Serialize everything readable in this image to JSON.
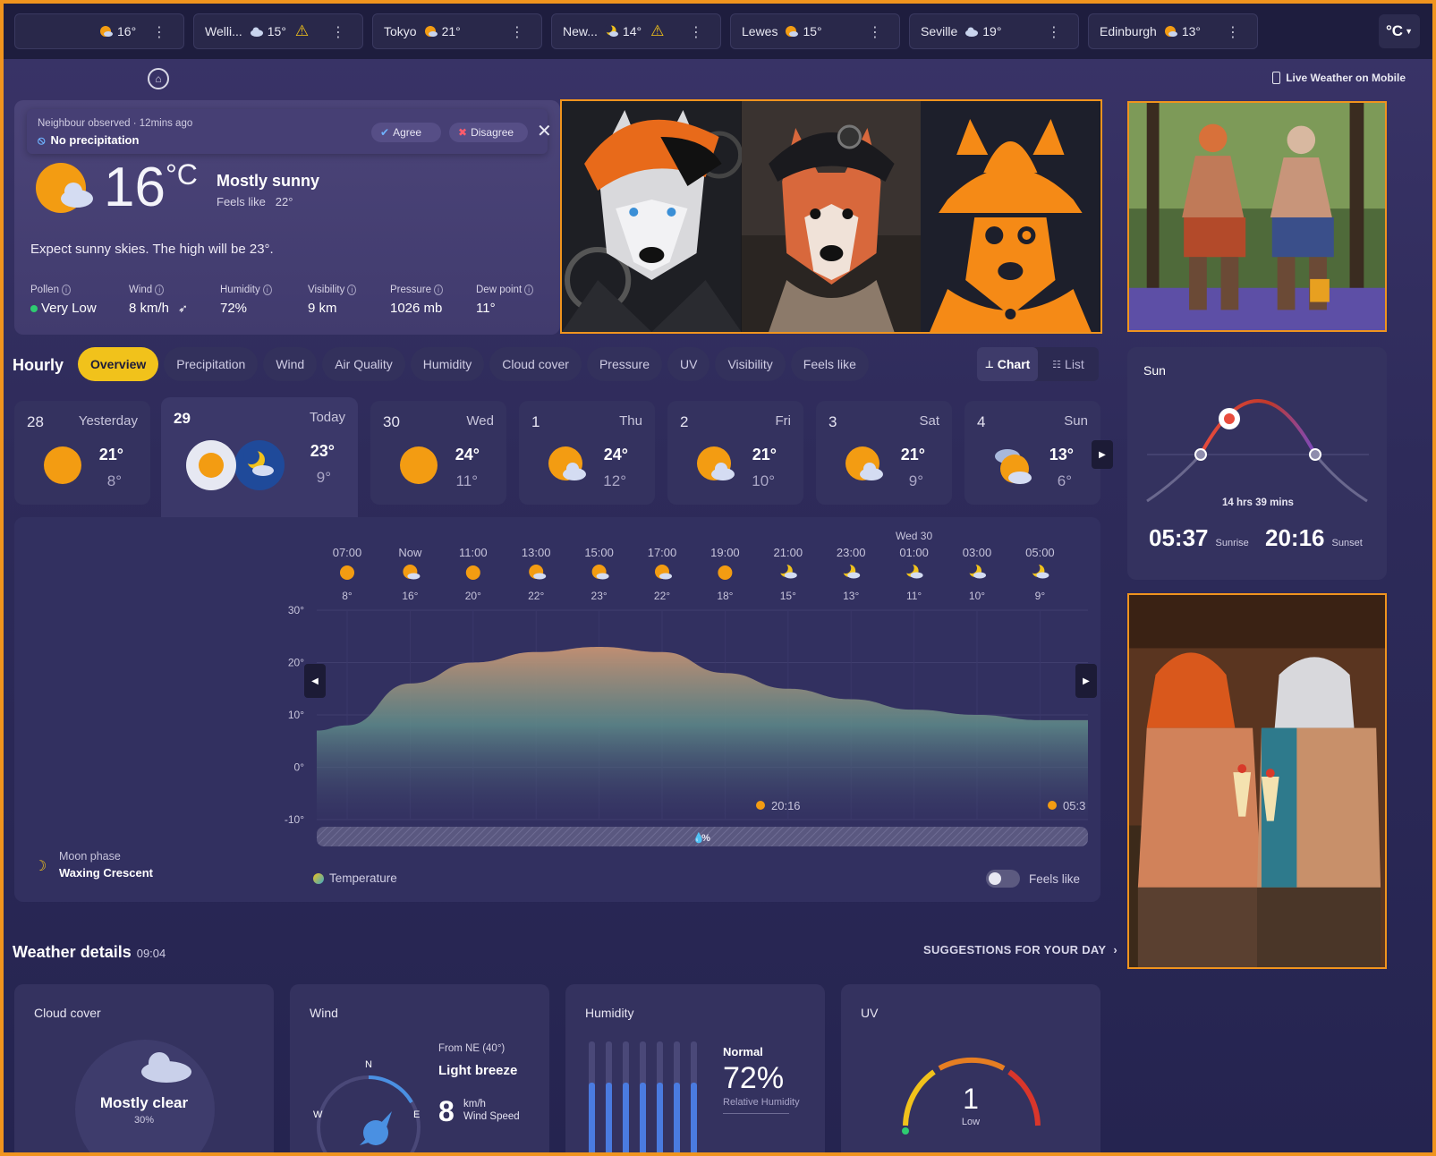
{
  "cities": [
    {
      "name": "",
      "temp": "16°",
      "icon": "sun-cloud-icon",
      "warning": false
    },
    {
      "name": "Welli...",
      "temp": "15°",
      "icon": "cloud-icon",
      "warning": true
    },
    {
      "name": "Tokyo",
      "temp": "21°",
      "icon": "sun-cloud-icon",
      "warning": false
    },
    {
      "name": "New...",
      "temp": "14°",
      "icon": "moon-cloud-icon",
      "warning": true
    },
    {
      "name": "Lewes",
      "temp": "15°",
      "icon": "sun-cloud-icon",
      "warning": false
    },
    {
      "name": "Seville",
      "temp": "19°",
      "icon": "cloud-icon",
      "warning": false
    },
    {
      "name": "Edinburgh",
      "temp": "13°",
      "icon": "sun-cloud-icon",
      "warning": false
    }
  ],
  "unit_button": "°C",
  "mobile_link": "Live Weather on Mobile",
  "observation": {
    "meta": "Neighbour observed · 12mins ago",
    "status": "No precipitation",
    "agree": "Agree",
    "disagree": "Disagree"
  },
  "current": {
    "temp": "16",
    "unit": "°C",
    "condition": "Mostly sunny",
    "feels_like_label": "Feels like",
    "feels_like": "22°",
    "summary": "Expect sunny skies. The high will be 23°."
  },
  "metrics": [
    {
      "label": "Pollen",
      "value": "Very Low"
    },
    {
      "label": "Wind",
      "value": "8 km/h"
    },
    {
      "label": "Humidity",
      "value": "72%"
    },
    {
      "label": "Visibility",
      "value": "9 km"
    },
    {
      "label": "Pressure",
      "value": "1026 mb"
    },
    {
      "label": "Dew point",
      "value": "11°"
    }
  ],
  "hourly": {
    "title": "Hourly",
    "tabs": [
      "Overview",
      "Precipitation",
      "Wind",
      "Air Quality",
      "Humidity",
      "Cloud cover",
      "Pressure",
      "UV",
      "Visibility",
      "Feels like"
    ],
    "active_tab": "Overview",
    "view_chart": "Chart",
    "view_list": "List"
  },
  "days": [
    {
      "num": "28",
      "label": "Yesterday",
      "hi": "21°",
      "lo": "8°",
      "icon": "sun-icon"
    },
    {
      "num": "29",
      "label": "Today",
      "hi": "23°",
      "lo": "9°",
      "icon": "sun-icon"
    },
    {
      "num": "30",
      "label": "Wed",
      "hi": "24°",
      "lo": "11°",
      "icon": "sun-icon"
    },
    {
      "num": "1",
      "label": "Thu",
      "hi": "24°",
      "lo": "12°",
      "icon": "sun-cloud-icon"
    },
    {
      "num": "2",
      "label": "Fri",
      "hi": "21°",
      "lo": "10°",
      "icon": "sun-cloud-icon"
    },
    {
      "num": "3",
      "label": "Sat",
      "hi": "21°",
      "lo": "9°",
      "icon": "sun-cloud-icon"
    },
    {
      "num": "4",
      "label": "Sun",
      "hi": "13°",
      "lo": "6°",
      "icon": "cloud-sun-icon"
    }
  ],
  "chart_data": {
    "type": "area",
    "x": [
      "07:00",
      "Now",
      "11:00",
      "13:00",
      "15:00",
      "17:00",
      "19:00",
      "21:00",
      "23:00",
      "01:00",
      "03:00",
      "05:00"
    ],
    "x_date_note": "Wed 30",
    "values": [
      8,
      16,
      20,
      22,
      23,
      22,
      18,
      15,
      13,
      11,
      10,
      9
    ],
    "value_labels": [
      "8°",
      "16°",
      "20°",
      "22°",
      "23°",
      "22°",
      "18°",
      "15°",
      "13°",
      "11°",
      "10°",
      "9°"
    ],
    "icons": [
      "sun-icon",
      "sun-cloud-icon",
      "sun-icon",
      "sun-cloud-icon",
      "sun-cloud-icon",
      "sun-cloud-icon",
      "sun-icon",
      "moon-cloud-icon",
      "moon-cloud-icon",
      "moon-cloud-icon",
      "moon-cloud-icon",
      "moon-cloud-icon"
    ],
    "y_ticks": [
      "30°",
      "20°",
      "10°",
      "0°",
      "-10°"
    ],
    "y_tick_values": [
      30,
      20,
      10,
      0,
      -10
    ],
    "ylim": [
      -10,
      30
    ],
    "sunset_label": "20:16",
    "sunrise_label": "05:3",
    "precip_label": "0%",
    "legend": "Temperature",
    "feels_toggle": "Feels like"
  },
  "moon": {
    "label": "Moon phase",
    "value": "Waxing Crescent"
  },
  "sun": {
    "title": "Sun",
    "day_length": "14 hrs 39 mins",
    "sunrise": "05:37",
    "sunrise_label": "Sunrise",
    "sunset": "20:16",
    "sunset_label": "Sunset"
  },
  "details": {
    "title": "Weather details",
    "time": "09:04",
    "suggestions": "SUGGESTIONS FOR YOUR DAY",
    "cloud": {
      "title": "Cloud cover",
      "value": "Mostly clear",
      "pct": "30%"
    },
    "wind": {
      "title": "Wind",
      "from": "From NE (40°)",
      "desc": "Light breeze",
      "speed": "8",
      "unit": "km/h",
      "speed_label": "Wind Speed",
      "n": "N",
      "w": "W",
      "e": "E"
    },
    "humidity": {
      "title": "Humidity",
      "level": "Normal",
      "value": "72%",
      "label": "Relative Humidity"
    },
    "uv": {
      "title": "UV",
      "value": "1",
      "level": "Low"
    }
  },
  "colors": {
    "accent": "#f1c21b",
    "frame": "#f0941e",
    "sun": "#f39c12"
  }
}
